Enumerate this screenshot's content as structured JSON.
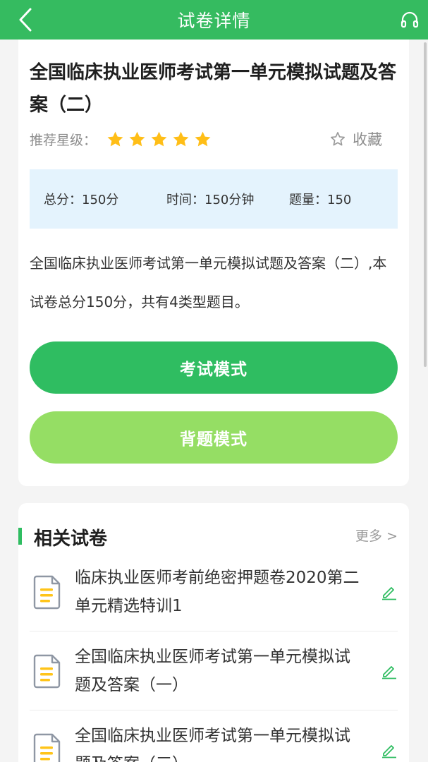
{
  "header": {
    "title": "试卷详情",
    "back_icon": "chevron-left-icon",
    "right_icon": "headset-icon"
  },
  "paper": {
    "title": "全国临床执业医师考试第一单元模拟试题及答案（二）",
    "rating_label": "推荐星级：",
    "rating": 5,
    "favorite_label": "收藏",
    "info": {
      "total_score": "总分：150分",
      "time": "时间：150分钟",
      "count": "题量：150"
    },
    "description": "全国临床执业医师考试第一单元模拟试题及答案（二）,本试卷总分150分，共有4类型题目。",
    "exam_button": "考试模式",
    "recite_button": "背题模式"
  },
  "related": {
    "title": "相关试卷",
    "more": "更多 >",
    "items": [
      {
        "title": "临床执业医师考前绝密押题卷2020第二单元精选特训1"
      },
      {
        "title": "全国临床执业医师考试第一单元模拟试题及答案（一）"
      },
      {
        "title": "全国临床执业医师考试第一单元模拟试题及答案（三）"
      }
    ]
  },
  "colors": {
    "brand_green": "#35bb60",
    "exam_button": "#2fbd61",
    "recite_button": "#95de64",
    "star": "#ffbe17",
    "info_bg": "#e4f3fd"
  }
}
